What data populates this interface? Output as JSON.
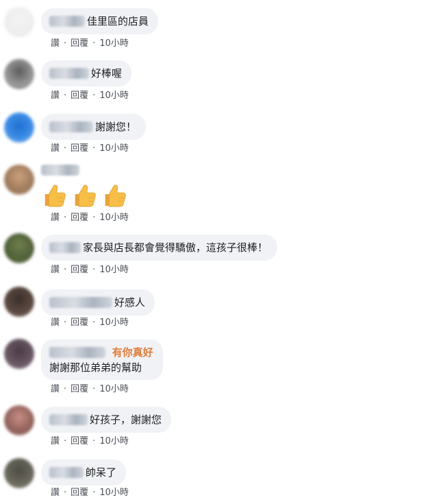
{
  "actions": {
    "like": "讚",
    "reply": "回覆",
    "time": "10小時",
    "separator": "·"
  },
  "comments": [
    {
      "text": "佳里區的店員"
    },
    {
      "text": "好棒喔"
    },
    {
      "text": "謝謝您！"
    },
    {
      "text": ""
    },
    {
      "text": "家長與店長都會覺得驕傲，這孩子很棒！"
    },
    {
      "text": "好感人"
    },
    {
      "badge": "有你真好",
      "text": "謝謝那位弟弟的幫助"
    },
    {
      "text": "好孩子，謝謝您"
    },
    {
      "text": "帥呆了"
    }
  ],
  "emoji": {
    "name": "thumbs-up-icon",
    "count": 3
  },
  "colors": {
    "bubble": "#f0f2f5",
    "badge": "#e07b39",
    "action_text": "#4b4f56"
  }
}
